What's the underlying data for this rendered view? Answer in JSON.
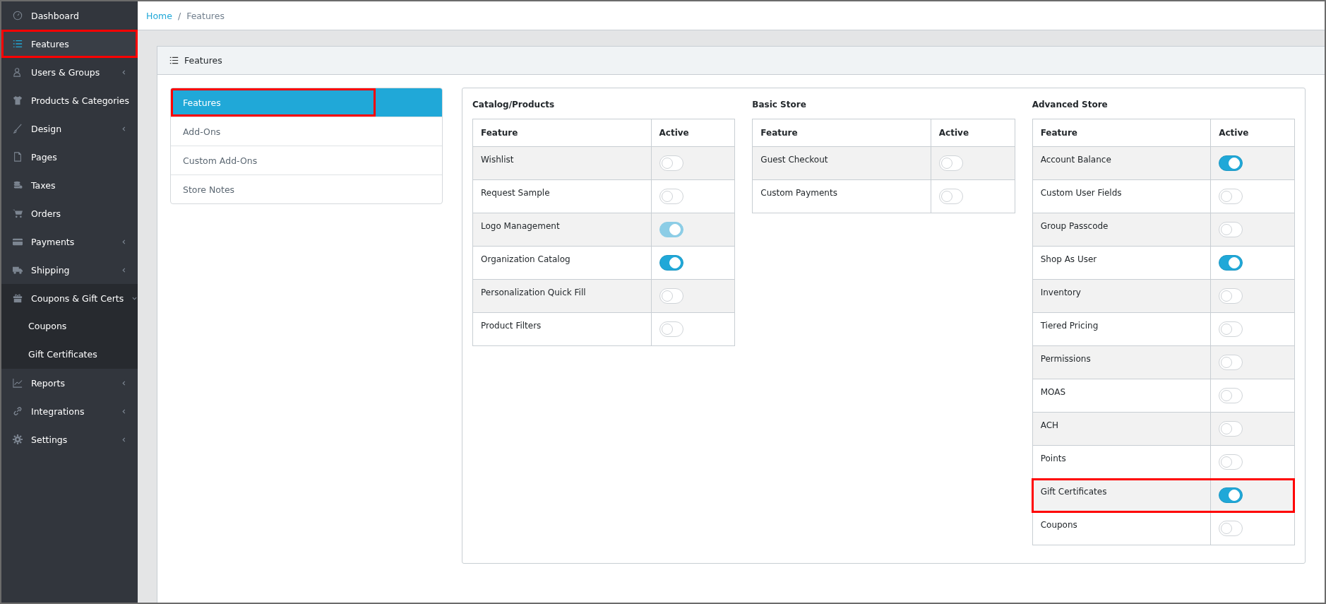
{
  "sidebar": {
    "items": [
      {
        "label": "Dashboard",
        "kind": "link",
        "selected": false,
        "highlighted": false
      },
      {
        "label": "Features",
        "kind": "link",
        "selected": true,
        "highlighted": true
      },
      {
        "label": "Users & Groups",
        "kind": "group",
        "expanded": false,
        "selected": false,
        "highlighted": false
      },
      {
        "label": "Products & Categories",
        "kind": "group",
        "expanded": false,
        "selected": false,
        "highlighted": false
      },
      {
        "label": "Design",
        "kind": "group",
        "expanded": false,
        "selected": false,
        "highlighted": false
      },
      {
        "label": "Pages",
        "kind": "link",
        "selected": false,
        "highlighted": false
      },
      {
        "label": "Taxes",
        "kind": "link",
        "selected": false,
        "highlighted": false
      },
      {
        "label": "Orders",
        "kind": "link",
        "selected": false,
        "highlighted": false
      },
      {
        "label": "Payments",
        "kind": "group",
        "expanded": false,
        "selected": false,
        "highlighted": false
      },
      {
        "label": "Shipping",
        "kind": "group",
        "expanded": false,
        "selected": false,
        "highlighted": false
      },
      {
        "label": "Coupons & Gift Certs",
        "kind": "group",
        "expanded": true,
        "selected": false,
        "highlighted": false,
        "children": [
          {
            "label": "Coupons"
          },
          {
            "label": "Gift Certificates"
          }
        ]
      },
      {
        "label": "Reports",
        "kind": "group",
        "expanded": false,
        "selected": false,
        "highlighted": false
      },
      {
        "label": "Integrations",
        "kind": "group",
        "expanded": false,
        "selected": false,
        "highlighted": false
      },
      {
        "label": "Settings",
        "kind": "group",
        "expanded": false,
        "selected": false,
        "highlighted": false
      }
    ]
  },
  "breadcrumb": [
    {
      "label": "Home",
      "kind": "link"
    },
    {
      "label": "/",
      "kind": "separator"
    },
    {
      "label": "Features",
      "kind": "current"
    }
  ],
  "card": {
    "title": "Features",
    "tabs": [
      {
        "label": "Features",
        "selected": true,
        "highlighted": true
      },
      {
        "label": "Add-Ons",
        "selected": false,
        "highlighted": false
      },
      {
        "label": "Custom Add-Ons",
        "selected": false,
        "highlighted": false
      },
      {
        "label": "Store Notes",
        "selected": false,
        "highlighted": false
      }
    ],
    "groups": [
      {
        "title": "Catalog/Products",
        "columns": [
          "Feature",
          "Active"
        ],
        "rows": [
          {
            "feature": "Wishlist",
            "on": false,
            "disabled": false,
            "highlighted": false
          },
          {
            "feature": "Request Sample",
            "on": false,
            "disabled": false,
            "highlighted": false
          },
          {
            "feature": "Logo Management",
            "on": true,
            "disabled": true,
            "highlighted": false
          },
          {
            "feature": "Organization Catalog",
            "on": true,
            "disabled": false,
            "highlighted": false
          },
          {
            "feature": "Personalization Quick Fill",
            "on": false,
            "disabled": false,
            "highlighted": false
          },
          {
            "feature": "Product Filters",
            "on": false,
            "disabled": false,
            "highlighted": false
          }
        ]
      },
      {
        "title": "Basic Store",
        "columns": [
          "Feature",
          "Active"
        ],
        "rows": [
          {
            "feature": "Guest Checkout",
            "on": false,
            "disabled": false,
            "highlighted": false
          },
          {
            "feature": "Custom Payments",
            "on": false,
            "disabled": false,
            "highlighted": false
          }
        ]
      },
      {
        "title": "Advanced Store",
        "columns": [
          "Feature",
          "Active"
        ],
        "rows": [
          {
            "feature": "Account Balance",
            "on": true,
            "disabled": false,
            "highlighted": false
          },
          {
            "feature": "Custom User Fields",
            "on": false,
            "disabled": false,
            "highlighted": false
          },
          {
            "feature": "Group Passcode",
            "on": false,
            "disabled": false,
            "highlighted": false
          },
          {
            "feature": "Shop As User",
            "on": true,
            "disabled": false,
            "highlighted": false
          },
          {
            "feature": "Inventory",
            "on": false,
            "disabled": false,
            "highlighted": false
          },
          {
            "feature": "Tiered Pricing",
            "on": false,
            "disabled": false,
            "highlighted": false
          },
          {
            "feature": "Permissions",
            "on": false,
            "disabled": false,
            "highlighted": false
          },
          {
            "feature": "MOAS",
            "on": false,
            "disabled": false,
            "highlighted": false
          },
          {
            "feature": "ACH",
            "on": false,
            "disabled": false,
            "highlighted": false
          },
          {
            "feature": "Points",
            "on": false,
            "disabled": false,
            "highlighted": false
          },
          {
            "feature": "Gift Certificates",
            "on": true,
            "disabled": false,
            "highlighted": true
          },
          {
            "feature": "Coupons",
            "on": false,
            "disabled": false,
            "highlighted": false
          }
        ]
      }
    ]
  }
}
